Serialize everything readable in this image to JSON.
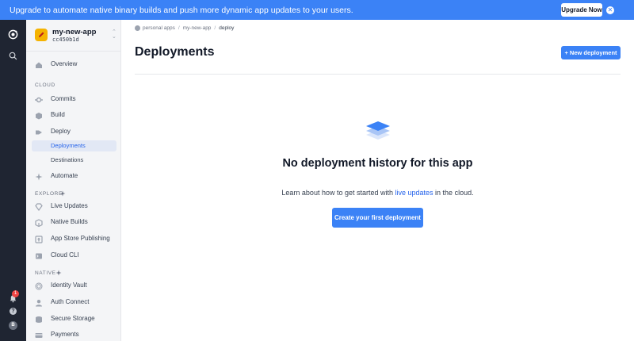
{
  "banner": {
    "text": "Upgrade to automate native binary builds and push more dynamic app updates to your users.",
    "upgrade_label": "Upgrade Now",
    "close_glyph": "✕"
  },
  "rail": {
    "badge_count": "1",
    "help_glyph": "?",
    "avatar_initial": "B"
  },
  "app": {
    "name": "my-new-app",
    "id": "cc450b1d",
    "chevron_up": "⌃",
    "chevron_down": "⌄"
  },
  "sidebar": {
    "overview": "Overview",
    "sections": {
      "cloud": "CLOUD",
      "explore": "EXPLORE",
      "native": "NATIVE"
    },
    "items": {
      "commits": "Commits",
      "build": "Build",
      "deploy": "Deploy",
      "deployments": "Deployments",
      "destinations": "Destinations",
      "automate": "Automate",
      "live_updates": "Live Updates",
      "native_builds": "Native Builds",
      "app_store_publishing": "App Store Publishing",
      "cloud_cli": "Cloud CLI",
      "identity_vault": "Identity Vault",
      "auth_connect": "Auth Connect",
      "secure_storage": "Secure Storage",
      "payments": "Payments"
    }
  },
  "breadcrumb": {
    "items": [
      "personal apps",
      "my-new-app",
      "deploy"
    ],
    "separator": "/"
  },
  "main": {
    "title": "Deployments",
    "new_button": "+ New deployment",
    "empty_title": "No deployment history for this app",
    "empty_desc_before": "Learn about how to get started with ",
    "empty_desc_link": "live updates",
    "empty_desc_after": " in the cloud.",
    "cta": "Create your first deployment"
  },
  "colors": {
    "accent": "#3b82f6",
    "rail": "#1f2532",
    "sidebar": "#f4f5f7",
    "app_icon": "#f5b301",
    "badge": "#ef4444"
  }
}
